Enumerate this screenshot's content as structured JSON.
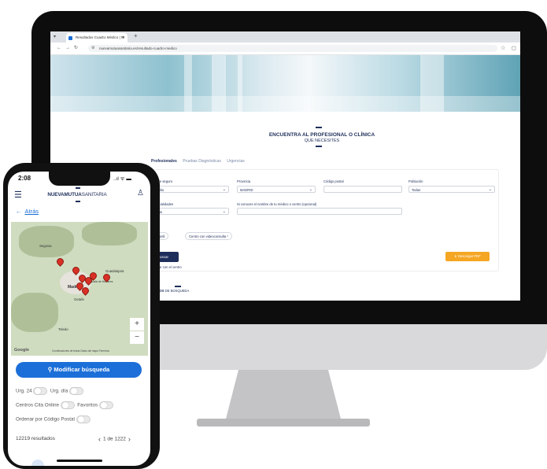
{
  "desktop": {
    "browser": {
      "tab_title": "Resultados Cuadro Médico | N",
      "url": "nuevamutuasanitaria.es/resultado-cuadro-medico"
    },
    "page": {
      "heading": "ENCUENTRA AL PROFESIONAL O CLÍNICA",
      "subheading": "QUE NECESITES",
      "tabs": [
        "Profesionales",
        "Pruebas Diagnósticas",
        "Urgencias"
      ],
      "fields": {
        "seguro_label": "o de seguro",
        "seguro_value": "amilia",
        "provincia_label": "Provincia",
        "provincia_value": "MADRID",
        "cp_label": "Código postal",
        "poblacion_label": "Población",
        "poblacion_value": "Todas",
        "especialidades_label": "pecialidades",
        "especialidades_value": "odas",
        "medico_label": "Si conoces el nombre de tu médico o centro (opcional)"
      },
      "chips": [
        "Infantil",
        "Centro con videoconsulta *"
      ],
      "buscar_label": "uscar",
      "pdf_label": "Descargar PDF",
      "consultar_label": "nsultar con el centro",
      "resultados_bold": "LTADOS",
      "resultados_rest": " DE BÚSQUEDA"
    }
  },
  "phone": {
    "status_time": "2:08",
    "status_icons": "..ıl ᯤ ▬",
    "brand_bold": "NUEVAMUTUA",
    "brand_light": "SANITARIA",
    "back_label": "Atrás",
    "map": {
      "labels": [
        "Segovia",
        "Guadalajara",
        "Alcalá de Henares",
        "Madrid",
        "Getafe",
        "Toledo",
        "Google"
      ],
      "legal": "Combinaciones de teclas  Datos del mapa  Términos"
    },
    "modify_button": "Modificar búsqueda",
    "toggles": [
      "Urg. 24",
      "Urg. día",
      "Centros Cita Online",
      "Favoritos",
      "Ordenar por Código Postal"
    ],
    "results_count": "12219 resultados",
    "page_indicator": "1 de 1222"
  },
  "colors": {
    "navy": "#1e2e5a",
    "blue": "#1c6fd8",
    "orange": "#f5a623",
    "pin_red": "#d93025"
  }
}
